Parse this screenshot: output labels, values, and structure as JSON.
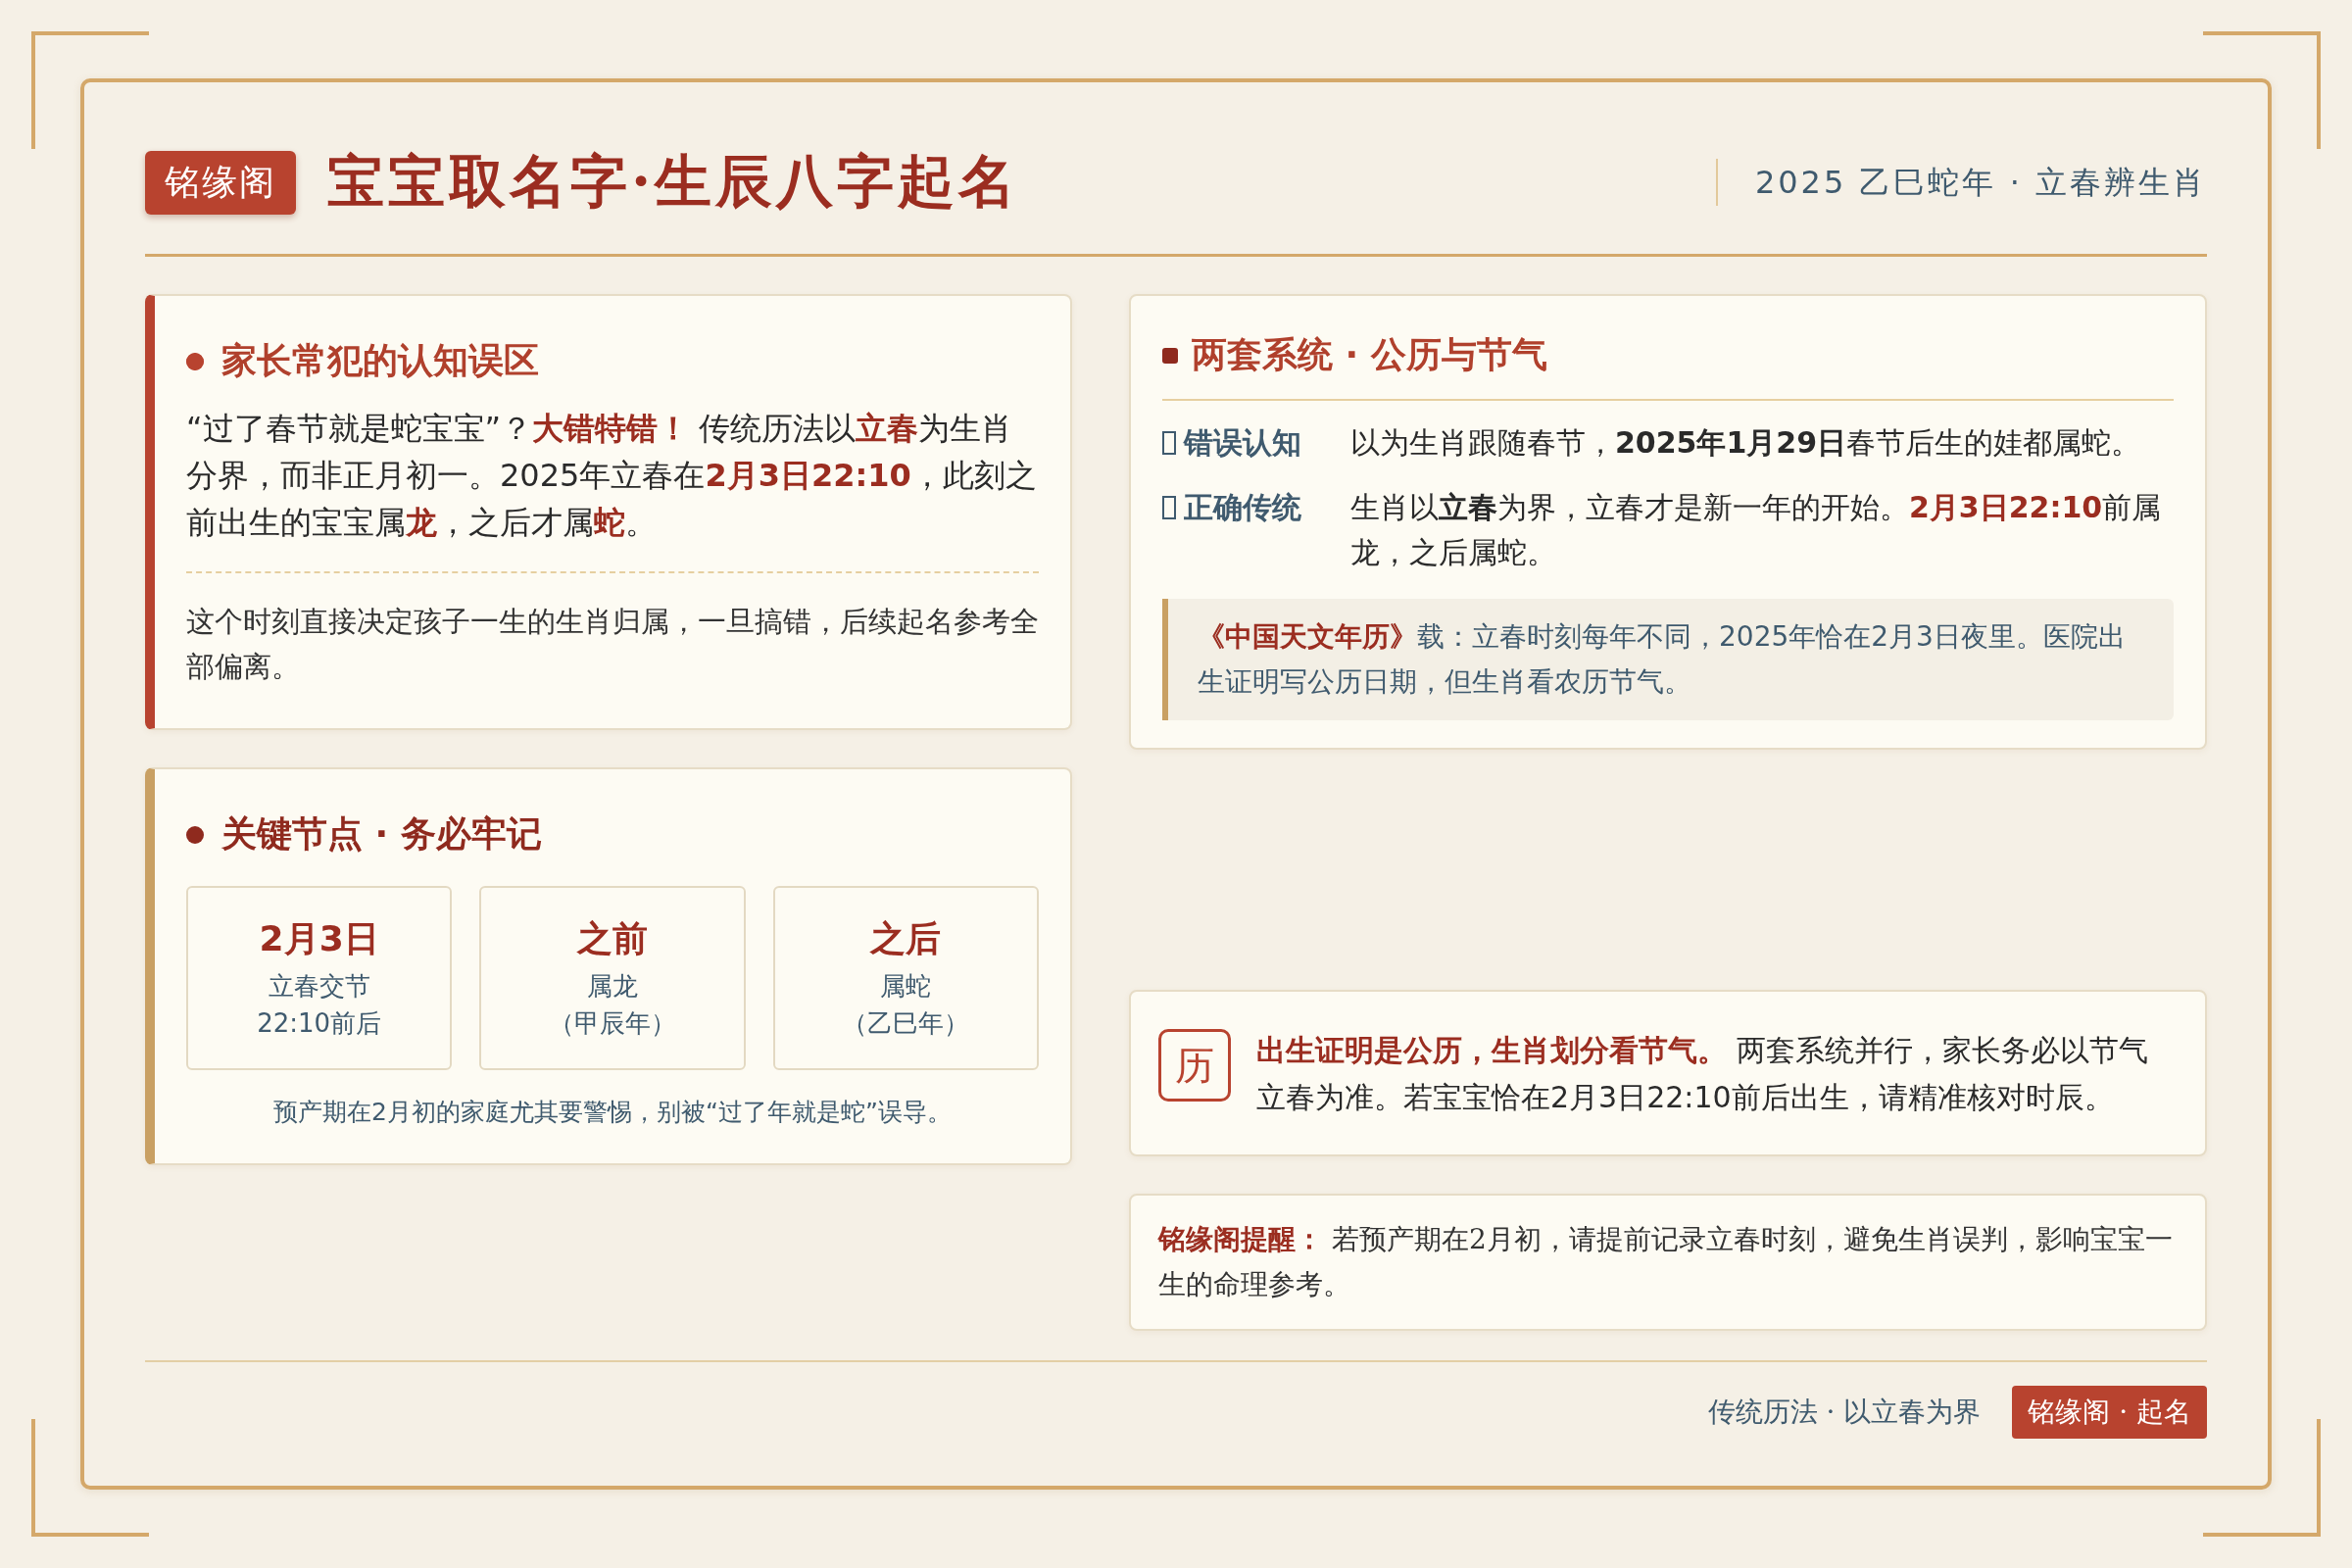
{
  "header": {
    "badge": "铭缘阁",
    "title": "宝宝取名字·生辰八字起名",
    "subtitle": "2025 乙巳蛇年 · 立春辨生肖"
  },
  "misconception_card": {
    "title": "家长常犯的认知误区",
    "body": [
      {
        "kind": "plain",
        "text": "“过了春节就是蛇宝宝”？"
      },
      {
        "kind": "accent",
        "text": "大错特错！"
      },
      {
        "kind": "plain",
        "text": " 传统历法以"
      },
      {
        "kind": "accent",
        "text": "立春"
      },
      {
        "kind": "plain",
        "text": "为生肖分界，而非正月初一。2025年立春在"
      },
      {
        "kind": "accent",
        "text": "2月3日22:10"
      },
      {
        "kind": "plain",
        "text": "，此刻之前出生的宝宝属"
      },
      {
        "kind": "accent",
        "text": "龙"
      },
      {
        "kind": "plain",
        "text": "，之后才属"
      },
      {
        "kind": "accent",
        "text": "蛇"
      },
      {
        "kind": "plain",
        "text": "。"
      }
    ],
    "note": "这个时刻直接决定孩子一生的生肖归属，一旦搞错，后续起名参考全部偏离。"
  },
  "key_points_card": {
    "title": "关键节点 · 务必牢记",
    "points": [
      {
        "heading": "2月3日",
        "lines": [
          "立春交节",
          "22:10前后"
        ]
      },
      {
        "heading": "之前",
        "lines": [
          "属龙",
          "（甲辰年）"
        ]
      },
      {
        "heading": "之后",
        "lines": [
          "属蛇",
          "（乙巳年）"
        ]
      }
    ],
    "caption": "预产期在2月初的家庭尤其要警惕，别被“过了年就是蛇”误导。"
  },
  "systems_card": {
    "title": "两套系统 · 公历与节气",
    "rows": [
      {
        "label": "错误认知",
        "text": [
          {
            "kind": "plain",
            "text": "以为生肖跟随春节，"
          },
          {
            "kind": "strong",
            "text": "2025年1月29日"
          },
          {
            "kind": "plain",
            "text": "春节后生的娃都属蛇。"
          }
        ]
      },
      {
        "label": "正确传统",
        "text": [
          {
            "kind": "plain",
            "text": "生肖以"
          },
          {
            "kind": "strong",
            "text": "立春"
          },
          {
            "kind": "plain",
            "text": "为界，立春才是新一年的开始。"
          },
          {
            "kind": "accent",
            "text": "2月3日22:10"
          },
          {
            "kind": "plain",
            "text": "前属龙，之后属蛇。"
          }
        ]
      }
    ],
    "quote": [
      {
        "kind": "accent",
        "text": "《中国天文年历》"
      },
      {
        "kind": "plain",
        "text": "载：立春时刻每年不同，2025年恰在2月3日夜里。医院出生证明写公历日期，但生肖看农历节气。"
      }
    ]
  },
  "summary_card": {
    "icon_text": "历",
    "text": [
      {
        "kind": "accent",
        "text": "出生证明是公历，生肖划分看节气。"
      },
      {
        "kind": "plain",
        "text": " 两套系统并行，家长务必以节气立春为准。若宝宝恰在2月3日22:10前后出生，请精准核对时辰。"
      }
    ]
  },
  "reminder_card": {
    "text": [
      {
        "kind": "accent",
        "text": "铭缘阁提醒："
      },
      {
        "kind": "plain",
        "text": " 若预产期在2月初，请提前记录立春时刻，避免生肖误判，影响宝宝一生的命理参考。"
      }
    ]
  },
  "footer": {
    "tagline": "传统历法 · 以立春为界",
    "badge": "铭缘阁 · 起名"
  }
}
